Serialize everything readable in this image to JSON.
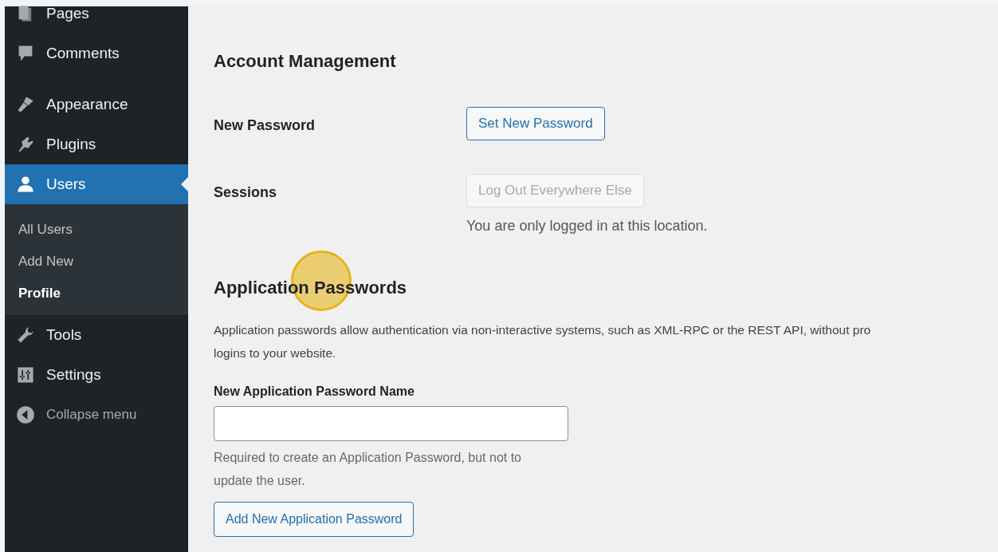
{
  "sidebar": {
    "items": [
      {
        "label": "Pages",
        "selected": false
      },
      {
        "label": "Comments",
        "selected": false
      },
      {
        "label": "Appearance",
        "selected": false
      },
      {
        "label": "Plugins",
        "selected": false
      },
      {
        "label": "Users",
        "selected": true,
        "children": [
          {
            "label": "All Users",
            "selected": false
          },
          {
            "label": "Add New",
            "selected": false
          },
          {
            "label": "Profile",
            "selected": true
          }
        ]
      },
      {
        "label": "Tools",
        "selected": false
      },
      {
        "label": "Settings",
        "selected": false
      }
    ],
    "collapse": "Collapse menu"
  },
  "account_management": {
    "heading": "Account Management",
    "rows": [
      {
        "label": "New Password",
        "button": "Set New Password",
        "disabled": false
      },
      {
        "label": "Sessions",
        "button": "Log Out Everywhere Else",
        "disabled": true,
        "note": "You are only logged in at this location."
      }
    ]
  },
  "application_passwords": {
    "heading": "Application Passwords",
    "description": [
      "Application passwords allow authentication via non-interactive systems, such as XML-RPC or the REST API, without pro",
      "logins to your website."
    ],
    "field_label": "New Application Password Name",
    "hint": "Required to create an Application Password, but not to update the user.",
    "button": "Add New Application Password"
  }
}
